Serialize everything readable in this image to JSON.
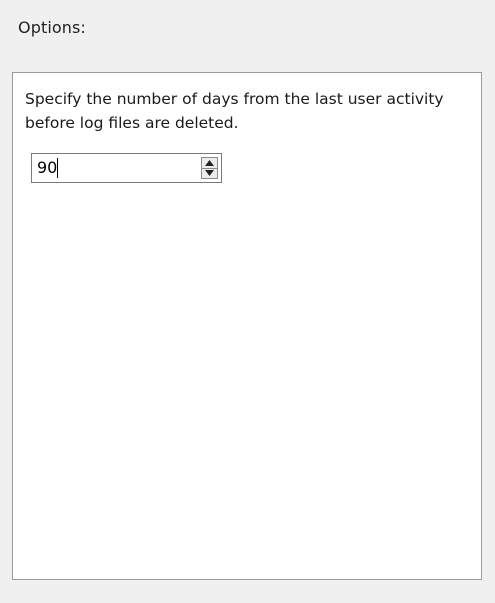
{
  "header": {
    "title": "Options:"
  },
  "panel": {
    "description": "Specify the number of days from the last user activity before log files are deleted."
  },
  "days_spinner": {
    "value": "90",
    "up_icon": "arrow-up-icon",
    "down_icon": "arrow-down-icon"
  }
}
